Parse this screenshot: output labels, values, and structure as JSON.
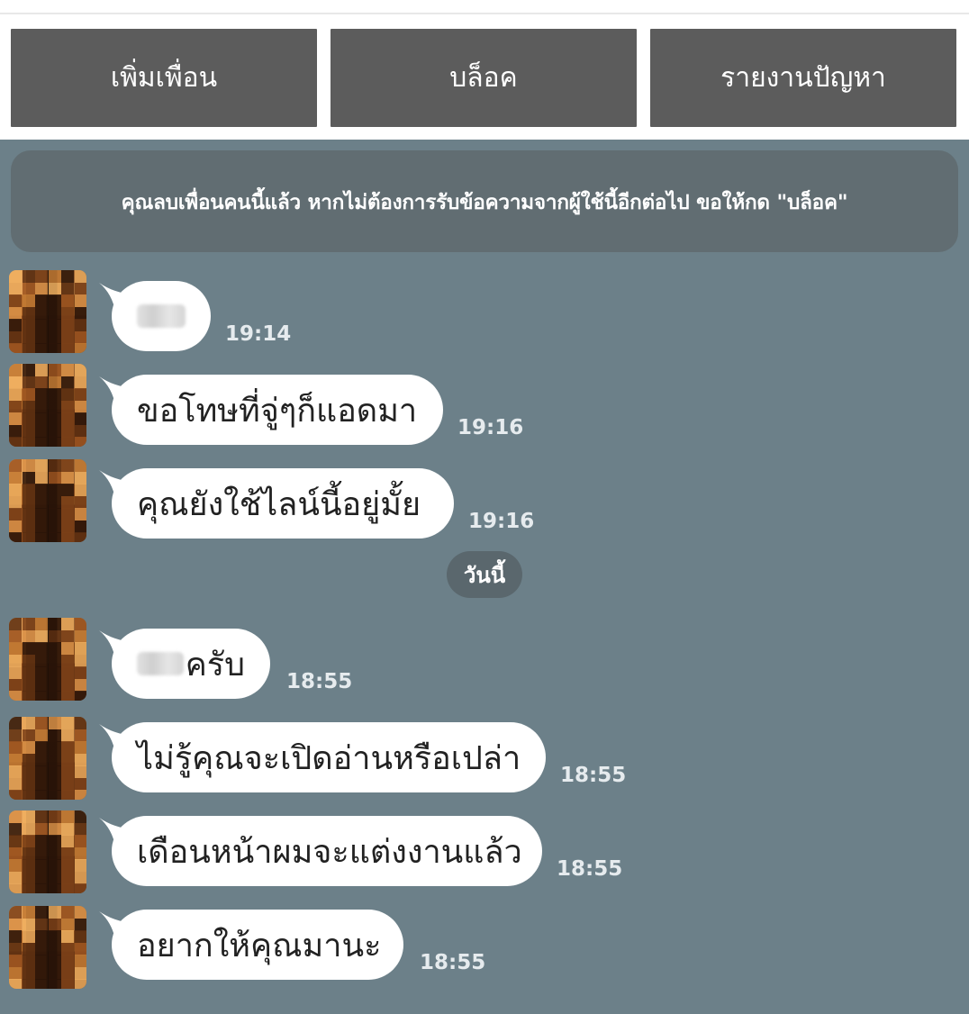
{
  "toolbar": {
    "add_friend_label": "เพิ่มเพื่อน",
    "block_label": "บล็อค",
    "report_label": "รายงานปัญหา"
  },
  "notice": {
    "text": "คุณลบเพื่อนคนนี้แล้ว หากไม่ต้องการรับข้อความจากผู้ใช้นี้อีกต่อไป ขอให้กด \"บล็อค\""
  },
  "date_separator": "วันนี้",
  "messages": [
    {
      "text": "",
      "time": "19:14",
      "redacted": true
    },
    {
      "text": "ขอโทษที่จู่ๆก็แอดมา",
      "time": "19:16"
    },
    {
      "text": "คุณยังใช้ไลน์นี้อยู่มั้ย",
      "time": "19:16"
    },
    {
      "text": "ครับ",
      "time": "18:55",
      "redacted_prefix": true
    },
    {
      "text": "ไม่รู้คุณจะเปิดอ่านหรือเปล่า",
      "time": "18:55"
    },
    {
      "text": "เดือนหน้าผมจะแต่งงานแล้ว",
      "time": "18:55"
    },
    {
      "text": "อยากให้คุณมานะ",
      "time": "18:55"
    }
  ]
}
